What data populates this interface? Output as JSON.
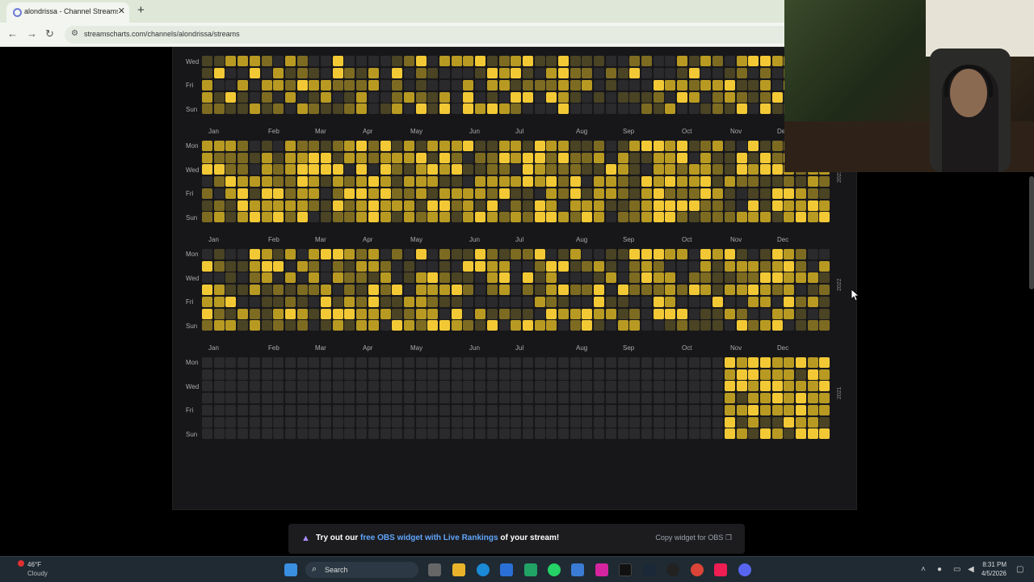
{
  "browser": {
    "tab_title": "alondrissa - Channel Streams on...",
    "url": "streamscharts.com/channels/alondrissa/streams",
    "back_icon": "back-arrow-icon",
    "forward_icon": "forward-arrow-icon",
    "reload_icon": "reload-icon",
    "site_info_icon": "site-info-icon"
  },
  "calendar": {
    "days": [
      "Mon",
      "Wed",
      "Fri",
      "Sun"
    ],
    "months": [
      "Jan",
      "Feb",
      "Mar",
      "Apr",
      "May",
      "Jun",
      "Jul",
      "Aug",
      "Sep",
      "Oct",
      "Nov",
      "Dec"
    ],
    "years": [
      {
        "year": "",
        "label_visible": false
      },
      {
        "year": "2023",
        "label_visible": true
      },
      {
        "year": "2022",
        "label_visible": true
      },
      {
        "year": "2021",
        "label_visible": true
      }
    ],
    "colors": {
      "empty": "#2a2a2c",
      "low": "#4a4324",
      "mid": "#7d6b22",
      "high": "#b89a22",
      "max": "#f2c935"
    }
  },
  "obs_banner": {
    "prefix": "Try out our ",
    "link": "free OBS widget with Live Rankings",
    "suffix": " of your stream!",
    "copy_label": "Copy widget for OBS"
  },
  "taskbar": {
    "temp": "46°F",
    "weather": "Cloudy",
    "search": "Search",
    "time": "8:31 PM",
    "date": "4/5/2026"
  }
}
